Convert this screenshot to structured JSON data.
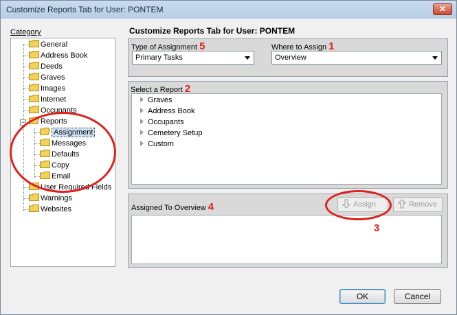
{
  "window": {
    "title": "Customize Reports Tab for User: PONTEM",
    "close_glyph": "✕"
  },
  "category": {
    "label": "Category",
    "items": [
      {
        "label": "General"
      },
      {
        "label": "Address Book"
      },
      {
        "label": "Deeds"
      },
      {
        "label": "Graves"
      },
      {
        "label": "Images"
      },
      {
        "label": "Internet"
      },
      {
        "label": "Occupants"
      },
      {
        "label": "Reports",
        "expanded": true,
        "expander": "−",
        "children": [
          {
            "label": "Assignment",
            "selected": true
          },
          {
            "label": "Messages"
          },
          {
            "label": "Defaults"
          },
          {
            "label": "Copy"
          },
          {
            "label": "Email"
          }
        ]
      },
      {
        "label": "User Required Fields"
      },
      {
        "label": "Warnings"
      },
      {
        "label": "Websites"
      }
    ]
  },
  "main": {
    "heading": "Customize Reports Tab for User: PONTEM",
    "type_of_assignment": {
      "label": "Type of Assignment",
      "annotation": "5",
      "value": "Primary Tasks"
    },
    "where_to_assign": {
      "label": "Where to Assign",
      "annotation": "1",
      "value": "Overview"
    },
    "select_report": {
      "label": "Select a Report",
      "annotation": "2",
      "items": [
        "Graves",
        "Address Book",
        "Occupants",
        "Cemetery Setup",
        "Custom"
      ]
    },
    "assigned": {
      "label": "Assigned To Overview",
      "annotation": "4",
      "assign_label": "Assign",
      "assign_annotation": "3",
      "remove_label": "Remove"
    }
  },
  "footer": {
    "ok_label": "OK",
    "cancel_label": "Cancel"
  },
  "colors": {
    "annotation": "#e0201c",
    "folder": "#f4d25a",
    "folder_edge": "#b08a1a"
  },
  "icons": {
    "folder": "folder-icon",
    "close": "close-icon",
    "assign": "arrow-down-icon",
    "remove": "arrow-up-icon",
    "expand": "triangle-right-icon"
  }
}
